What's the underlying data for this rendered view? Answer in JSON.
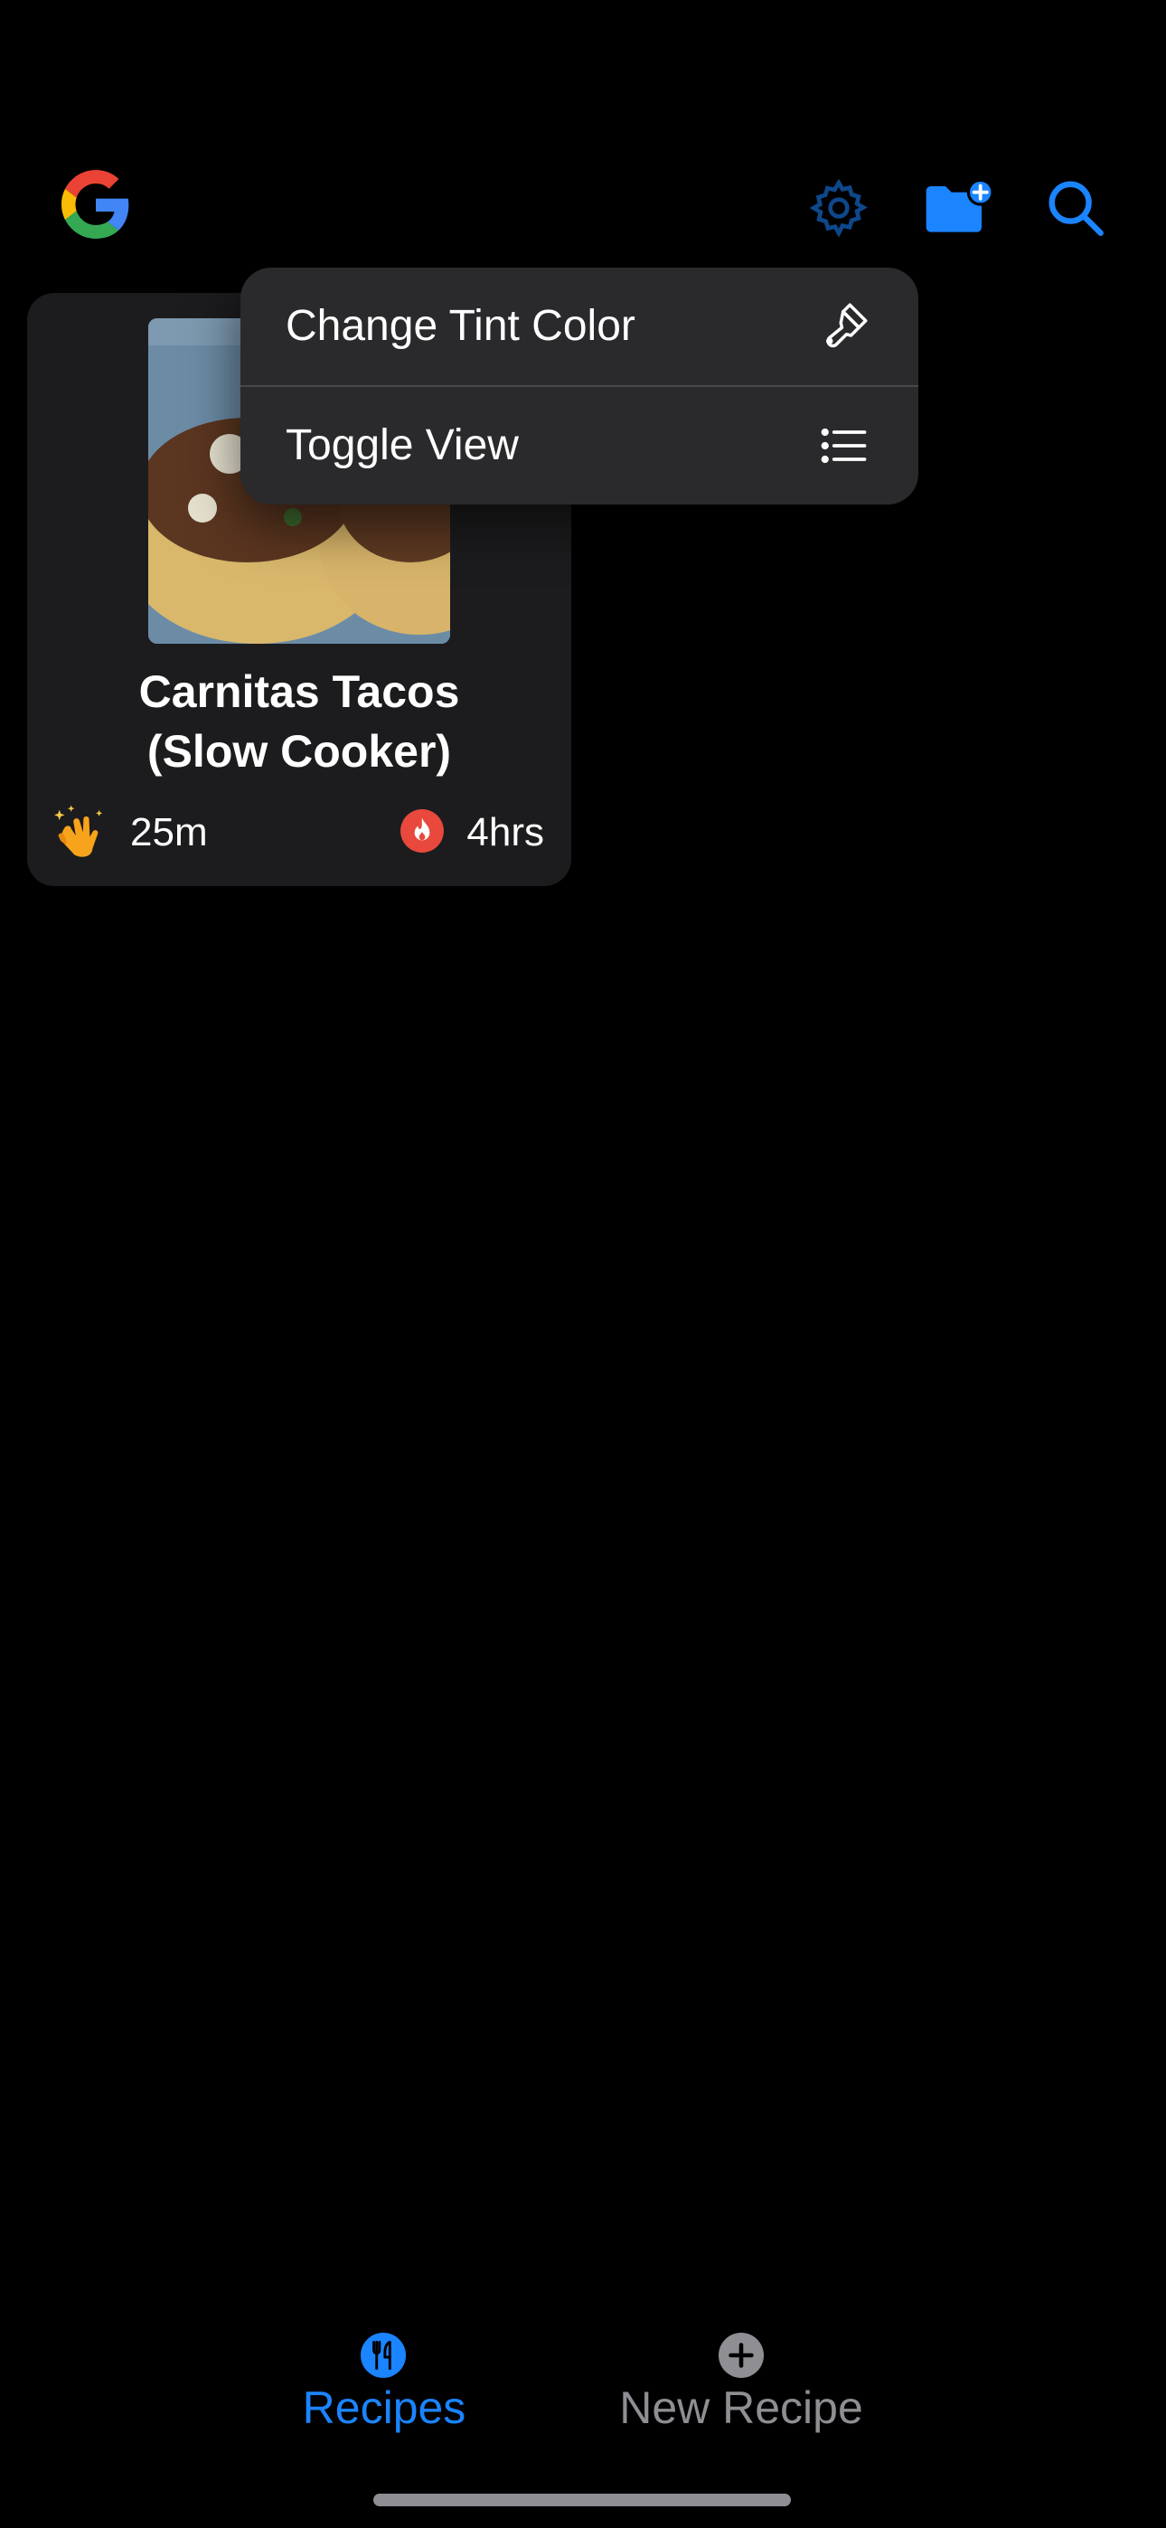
{
  "colors": {
    "accent": "#1b84ff",
    "background": "#000000",
    "card": "#1c1c1e",
    "menu": "#2a2a2c",
    "inactive_tab": "#8e8e93"
  },
  "toolbar": {
    "logo_icon": "google-logo",
    "settings_icon": "gear-icon",
    "new_folder_icon": "folder-plus-icon",
    "search_icon": "magnifier-icon"
  },
  "recipe": {
    "title_line1": "Carnitas Tacos",
    "title_line2": "(Slow Cooker)",
    "prep_icon": "clapping-hands-emoji",
    "prep_time": "25m",
    "cook_icon": "flame-icon",
    "cook_time": "4hrs"
  },
  "context_menu": {
    "items": [
      {
        "label": "Change Tint Color",
        "icon": "paintbrush-icon"
      },
      {
        "label": "Toggle View",
        "icon": "list-icon"
      }
    ]
  },
  "tab_bar": {
    "tabs": [
      {
        "label": "Recipes",
        "icon": "fork-knife-icon",
        "selected": true
      },
      {
        "label": "New Recipe",
        "icon": "plus-circle-icon",
        "selected": false
      }
    ]
  }
}
